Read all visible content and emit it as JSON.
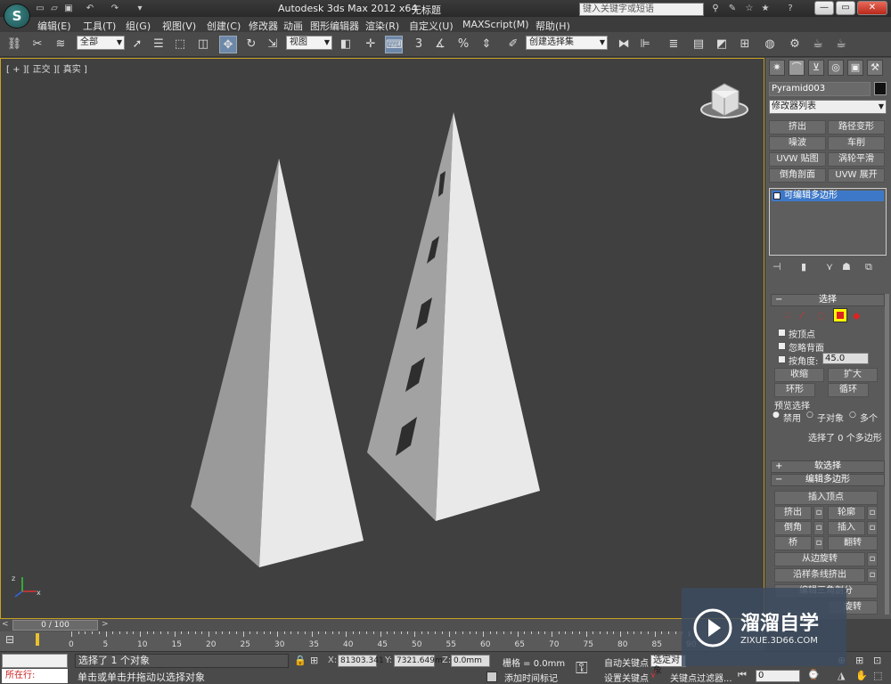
{
  "title_bar": {
    "app_title": "Autodesk 3ds Max  2012 x64",
    "doc_title": "无标题",
    "search_placeholder": "键入关键字或短语",
    "logo_letter": "S"
  },
  "menu": [
    "编辑(E)",
    "工具(T)",
    "组(G)",
    "视图(V)",
    "创建(C)",
    "修改器",
    "动画",
    "图形编辑器",
    "渲染(R)",
    "自定义(U)",
    "MAXScript(M)",
    "帮助(H)"
  ],
  "toolbar": {
    "selection_filter": "全部",
    "ref_coord": "视图",
    "named_selection": "创建选择集",
    "snap_label": "3"
  },
  "viewport": {
    "label": "[ + ][ 正交 ][ 真实 ]",
    "axis_labels": [
      "x",
      "y",
      "z"
    ]
  },
  "command_panel": {
    "object_name": "Pyramid003",
    "modifier_list": "修改器列表",
    "modifier_buttons": [
      "挤出",
      "路径变形",
      "噪波",
      "车削",
      "UVW 贴图",
      "涡轮平滑",
      "倒角剖面",
      "UVW 展开"
    ],
    "stack_item": "可编辑多边形",
    "selection_rollout": {
      "title": "选择",
      "by_vertex": "按顶点",
      "ignore_backfacing": "忽略背面",
      "by_angle": "按角度:",
      "angle_value": "45.0",
      "shrink": "收缩",
      "grow": "扩大",
      "ring": "环形",
      "loop": "循环",
      "preview_title": "预览选择",
      "preview_options": [
        "禁用",
        "子对象",
        "多个"
      ],
      "status": "选择了 0 个多边形"
    },
    "soft_selection": "软选择",
    "edit_polygons": {
      "title": "编辑多边形",
      "insert_vertex": "插入顶点",
      "extrude": "挤出",
      "outline": "轮廓",
      "bevel": "倒角",
      "inset": "插入",
      "bridge": "桥",
      "flip": "翻转",
      "hinge": "从边旋转",
      "extrude_spline": "沿样条线挤出",
      "edit_tri": "编辑三角剖分",
      "turn": "旋转"
    }
  },
  "timeline": {
    "frame": "0 / 100",
    "ticks": [
      "0",
      "5",
      "10",
      "15",
      "20",
      "25",
      "30",
      "35",
      "40",
      "45",
      "50",
      "55",
      "60",
      "65",
      "70",
      "75",
      "80",
      "85",
      "90"
    ]
  },
  "status_bar": {
    "script_label": "所在行:",
    "selected": "选择了 1 个对象",
    "prompt": "单击或单击并拖动以选择对象",
    "x_label": "X:",
    "x_value": "81303.341",
    "y_label": "Y:",
    "y_value": "7321.649m",
    "z_label": "Z:",
    "z_value": "0.0mm",
    "grid": "栅格 = 0.0mm",
    "add_time_tag": "添加时间标记",
    "auto_key": "自动关键点",
    "set_key": "设置关键点",
    "selected_dd": "选定对象",
    "key_filters": "关键点过滤器...",
    "frame_field": "0"
  },
  "watermark": {
    "brand": "溜溜自学",
    "url": "ZIXUE.3D66.COM"
  }
}
